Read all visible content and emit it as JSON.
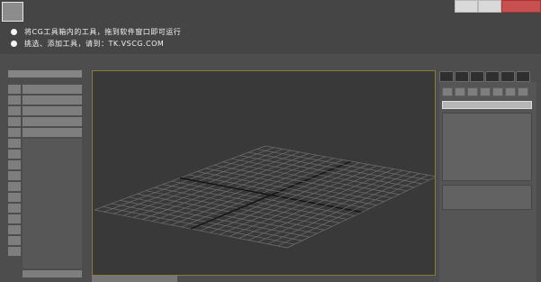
{
  "window": {
    "tips": [
      "将CG工具箱内的工具，拖到软件窗口即可运行",
      "挑选、添加工具，请到：TK.VSCG.COM"
    ]
  },
  "left_panel": {
    "icon_count": 16,
    "row_count": 5
  },
  "right_panel": {
    "tab_count": 6,
    "button_count": 7
  },
  "viewport": {
    "grid_divisions": 20
  },
  "colors": {
    "background": "#4d4d4d",
    "viewport_bg": "#393939",
    "viewport_border": "#8a7a3c",
    "grid_line": "#6f6f6f",
    "grid_axis": "#141414"
  }
}
